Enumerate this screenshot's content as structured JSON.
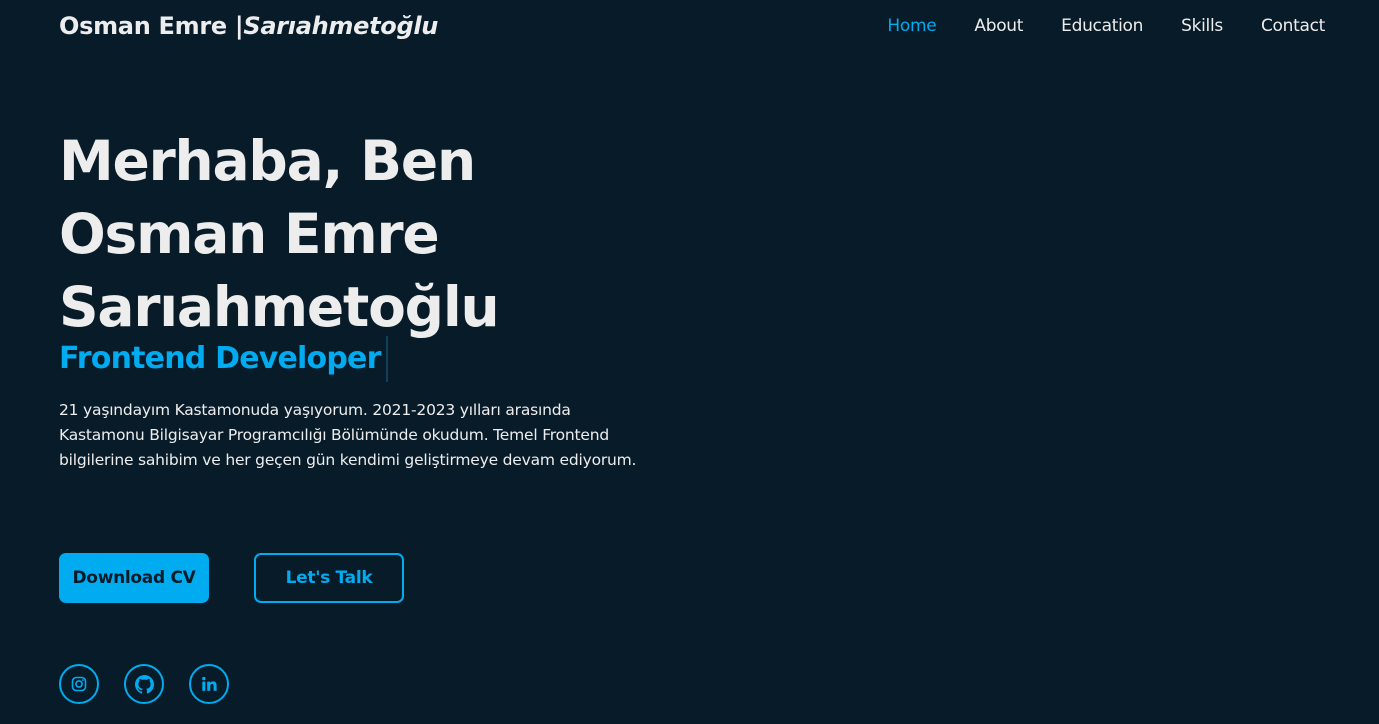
{
  "header": {
    "logo_name": "Osman Emre |",
    "logo_surname": "Sarıahmetoğlu",
    "nav": [
      {
        "label": "Home",
        "active": true
      },
      {
        "label": "About",
        "active": false
      },
      {
        "label": "Education",
        "active": false
      },
      {
        "label": "Skills",
        "active": false
      },
      {
        "label": "Contact",
        "active": false
      }
    ]
  },
  "hero": {
    "title_lines": [
      "Merhaba, Ben",
      "Osman Emre",
      "Sarıahmetoğlu"
    ],
    "role": "Frontend Developer",
    "description": "21 yaşındayım Kastamonuda yaşıyorum. 2021-2023 yılları arasında Kastamonu Bilgisayar Programcılığı Bölümünde okudum. Temel Frontend bilgilerine sahibim ve her geçen gün kendimi geliştirmeye devam ediyorum."
  },
  "buttons": {
    "download_cv": "Download CV",
    "lets_talk": "Let's Talk"
  },
  "socials": [
    {
      "icon": "instagram-icon"
    },
    {
      "icon": "github-icon"
    },
    {
      "icon": "linkedin-icon"
    }
  ],
  "colors": {
    "background": "#081b29",
    "accent": "#00abf0",
    "text": "#ededed"
  }
}
